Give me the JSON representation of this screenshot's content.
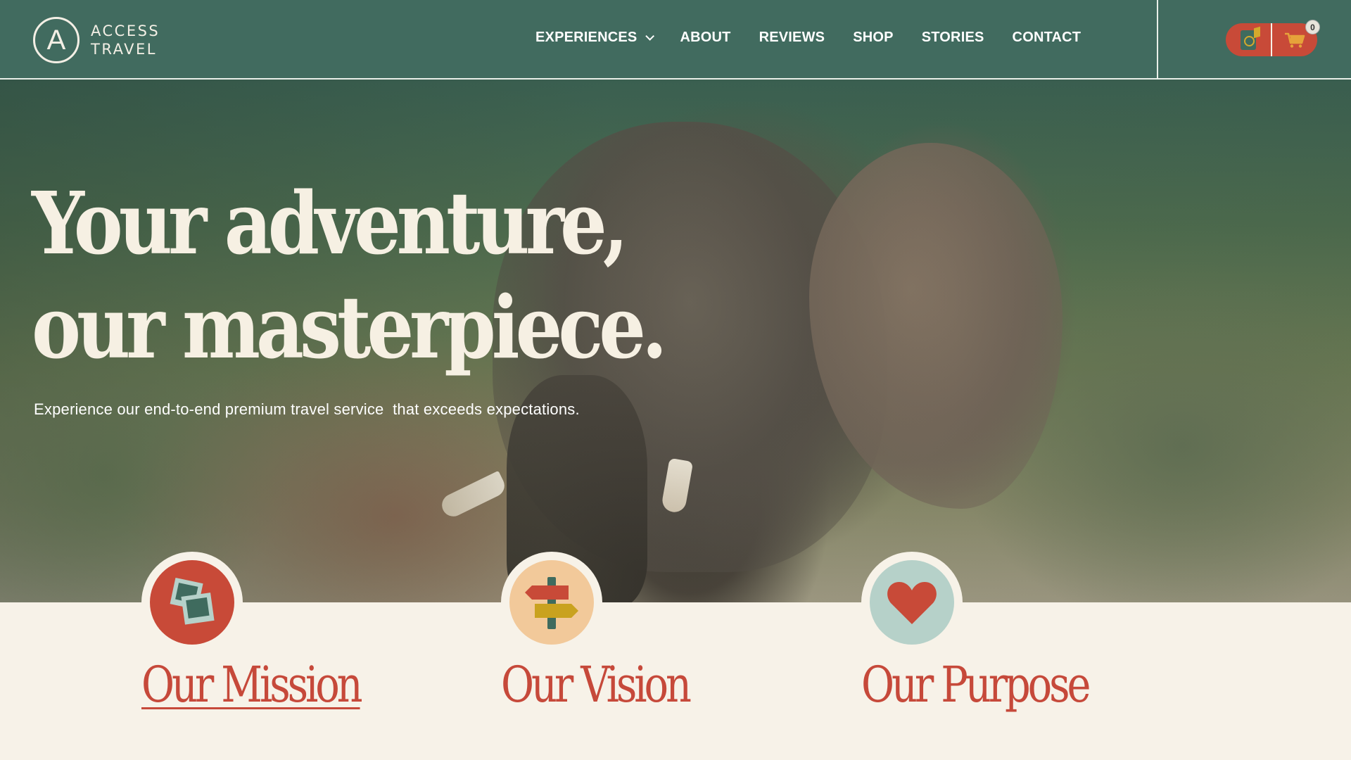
{
  "brand": {
    "line1": "ACCESS",
    "line2": "TRAVEL",
    "icon": "compass-a-logo-icon"
  },
  "nav": {
    "items": [
      {
        "label": "EXPERIENCES",
        "has_dropdown": true
      },
      {
        "label": "ABOUT"
      },
      {
        "label": "REVIEWS"
      },
      {
        "label": "SHOP"
      },
      {
        "label": "STORIES"
      },
      {
        "label": "CONTACT"
      }
    ]
  },
  "header_actions": {
    "passport_icon": "passport-icon",
    "cart_icon": "shopping-cart-icon",
    "cart_count": "0"
  },
  "hero": {
    "title_line1": "Your adventure,",
    "title_line2": "our masterpiece.",
    "subtitle": "Experience our end-to-end premium travel service  that exceeds expectations."
  },
  "values": [
    {
      "title": "Our Mission",
      "icon": "photos-icon"
    },
    {
      "title": "Our Vision",
      "icon": "signpost-icon"
    },
    {
      "title": "Our Purpose",
      "icon": "heart-icon"
    }
  ],
  "colors": {
    "header_bg": "#416b5f",
    "accent_red": "#c84a38",
    "cream": "#f7f2e8",
    "mint": "#b6d1c9",
    "peach": "#f2c99a"
  }
}
